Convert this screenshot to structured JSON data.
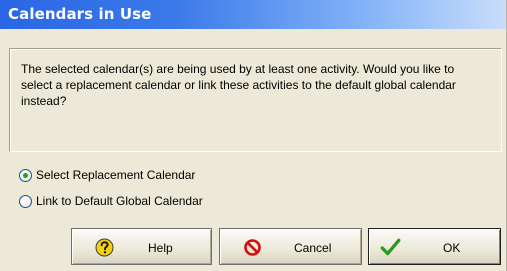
{
  "window": {
    "title": "Calendars in Use"
  },
  "message": {
    "text": "The selected calendar(s) are being used by at least one activity. Would you like to select a replacement calendar or link these activities to the default global calendar instead?"
  },
  "options": [
    {
      "label": "Select Replacement Calendar",
      "selected": true
    },
    {
      "label": "Link to Default Global Calendar",
      "selected": false
    }
  ],
  "buttons": {
    "help": {
      "label": "Help",
      "icon": "help-icon"
    },
    "cancel": {
      "label": "Cancel",
      "icon": "cancel-icon"
    },
    "ok": {
      "label": "OK",
      "icon": "checkmark-icon"
    }
  },
  "colors": {
    "titlebar_start": "#2a66e4",
    "dialog_bg": "#ece9d8",
    "radio_selected": "#21a121",
    "cancel_red": "#d01010",
    "ok_green": "#2b9a22",
    "help_yellow": "#f6d20e"
  }
}
